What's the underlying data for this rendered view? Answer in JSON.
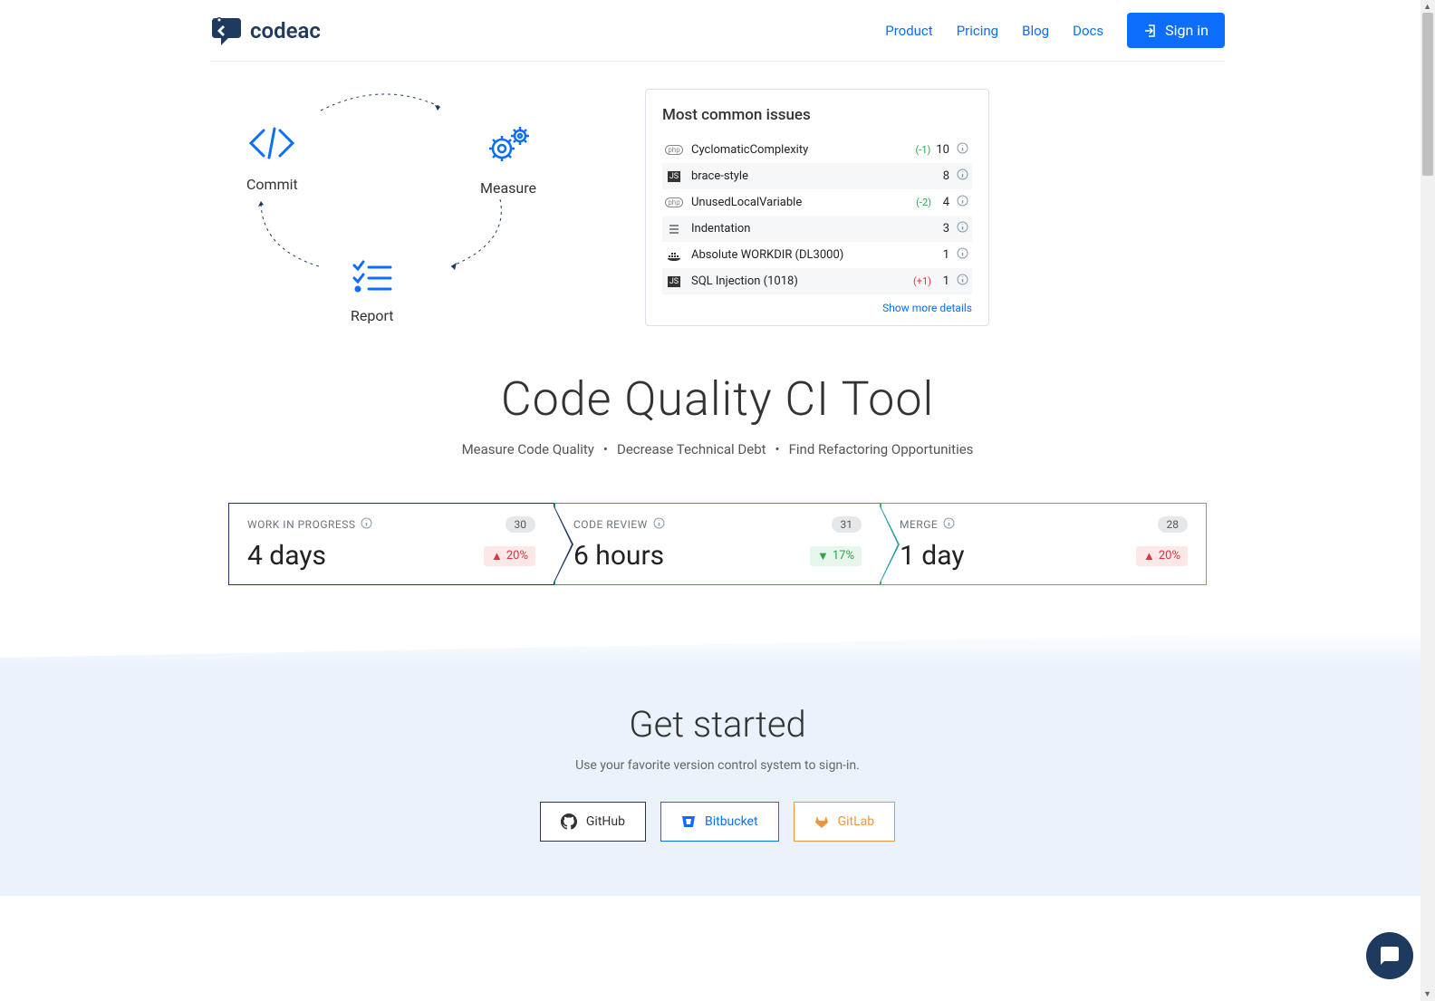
{
  "nav": {
    "brand": "codeac",
    "items": [
      "Product",
      "Pricing",
      "Blog",
      "Docs"
    ],
    "signin": "Sign in"
  },
  "cycle": {
    "commit": "Commit",
    "measure": "Measure",
    "report": "Report"
  },
  "issues": {
    "title": "Most common issues",
    "rows": [
      {
        "name": "CyclomaticComplexity",
        "delta": "(-1)",
        "deltaClass": "green",
        "count": "10",
        "lang": "php"
      },
      {
        "name": "brace-style",
        "delta": "",
        "deltaClass": "",
        "count": "8",
        "lang": "js"
      },
      {
        "name": "UnusedLocalVariable",
        "delta": "(-2)",
        "deltaClass": "green",
        "count": "4",
        "lang": "php"
      },
      {
        "name": "Indentation",
        "delta": "",
        "deltaClass": "",
        "count": "3",
        "lang": "scala"
      },
      {
        "name": "Absolute WORKDIR (DL3000)",
        "delta": "",
        "deltaClass": "",
        "count": "1",
        "lang": "docker"
      },
      {
        "name": "SQL Injection (1018)",
        "delta": "(+1)",
        "deltaClass": "red",
        "count": "1",
        "lang": "js"
      }
    ],
    "showMore": "Show more details"
  },
  "hero": {
    "title": "Code Quality CI Tool",
    "tag1": "Measure Code Quality",
    "tag2": "Decrease Technical Debt",
    "tag3": "Find Refactoring Opportunities"
  },
  "stages": [
    {
      "title": "WORK IN PROGRESS",
      "count": "30",
      "value": "4 days",
      "pct": "20%",
      "dir": "up"
    },
    {
      "title": "CODE REVIEW",
      "count": "31",
      "value": "6 hours",
      "pct": "17%",
      "dir": "down"
    },
    {
      "title": "MERGE",
      "count": "28",
      "value": "1 day",
      "pct": "20%",
      "dir": "up"
    }
  ],
  "getStarted": {
    "title": "Get started",
    "sub": "Use your favorite version control system to sign-in.",
    "github": "GitHub",
    "bitbucket": "Bitbucket",
    "gitlab": "GitLab"
  }
}
